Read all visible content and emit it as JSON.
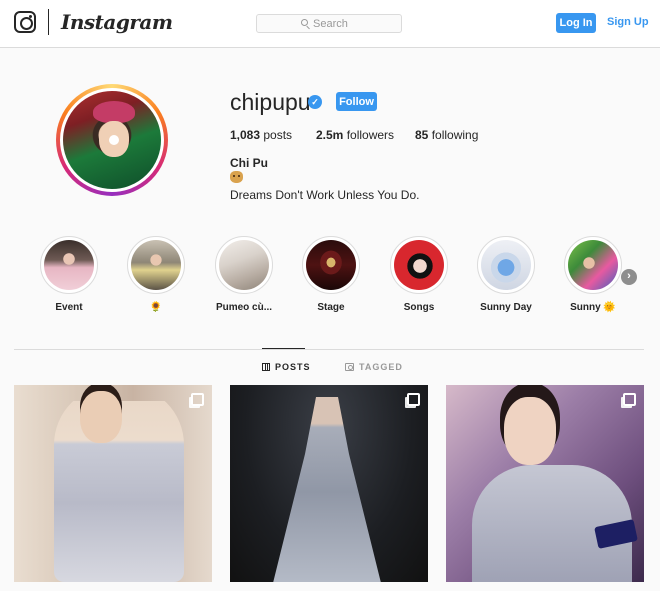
{
  "nav": {
    "brand": "Instagram",
    "search_placeholder": "Search",
    "login_label": "Log In",
    "signup_label": "Sign Up"
  },
  "profile": {
    "username": "chipupu",
    "verified_mark": "✓",
    "follow_label": "Follow",
    "stats": {
      "posts_count": "1,083",
      "posts_label": "posts",
      "followers_count": "2.5m",
      "followers_label": "followers",
      "following_count": "85",
      "following_label": "following"
    },
    "full_name": "Chi Pu",
    "bio": "Dreams Don't Work Unless You Do."
  },
  "highlights": [
    {
      "label": "Event"
    },
    {
      "label": "🌻"
    },
    {
      "label": "Pumeo cù..."
    },
    {
      "label": "Stage"
    },
    {
      "label": "Songs"
    },
    {
      "label": "Sunny Day"
    },
    {
      "label": "Sunny 🌞"
    }
  ],
  "highlights_next_icon": "›",
  "tabs": [
    {
      "label": "POSTS",
      "active": true,
      "icon": "grid-icon"
    },
    {
      "label": "TAGGED",
      "active": false,
      "icon": "tag-icon"
    }
  ],
  "posts": [
    {
      "type": "carousel",
      "icon": "multiple-photos-icon"
    },
    {
      "type": "carousel",
      "icon": "multiple-photos-icon"
    },
    {
      "type": "carousel",
      "icon": "multiple-photos-icon"
    }
  ],
  "colors": {
    "accent": "#3897f0",
    "text": "#262626",
    "border": "#dbdbdb",
    "background": "#fafafa"
  }
}
